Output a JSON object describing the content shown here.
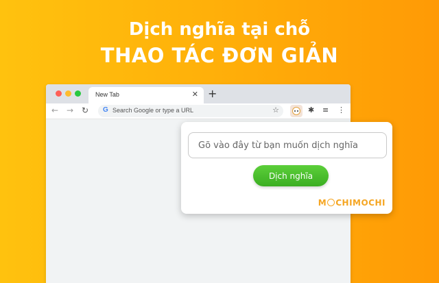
{
  "headline": {
    "line1": "Dịch nghĩa tại chỗ",
    "line2": "THAO TÁC ĐƠN GIẢN"
  },
  "browser": {
    "tab_title": "New Tab",
    "tab_close": "✕",
    "new_tab": "+",
    "omnibox_placeholder": "Search Google or type a URL",
    "icons": {
      "back": "←",
      "forward": "→",
      "reload": "↻",
      "google": "G",
      "star": "☆",
      "puzzle": "✱",
      "playlist": "≡",
      "menu": "⋮"
    }
  },
  "popup": {
    "input_placeholder": "Gõ vào đây từ bạn muốn dịch nghĩa",
    "button_label": "Dịch nghĩa",
    "brand_m": "M",
    "brand_rest": "CHIMOCHI"
  },
  "colors": {
    "background_start": "#ffc20e",
    "background_end": "#ff9a05",
    "button": "#3bae22",
    "brand": "#f5a623"
  }
}
